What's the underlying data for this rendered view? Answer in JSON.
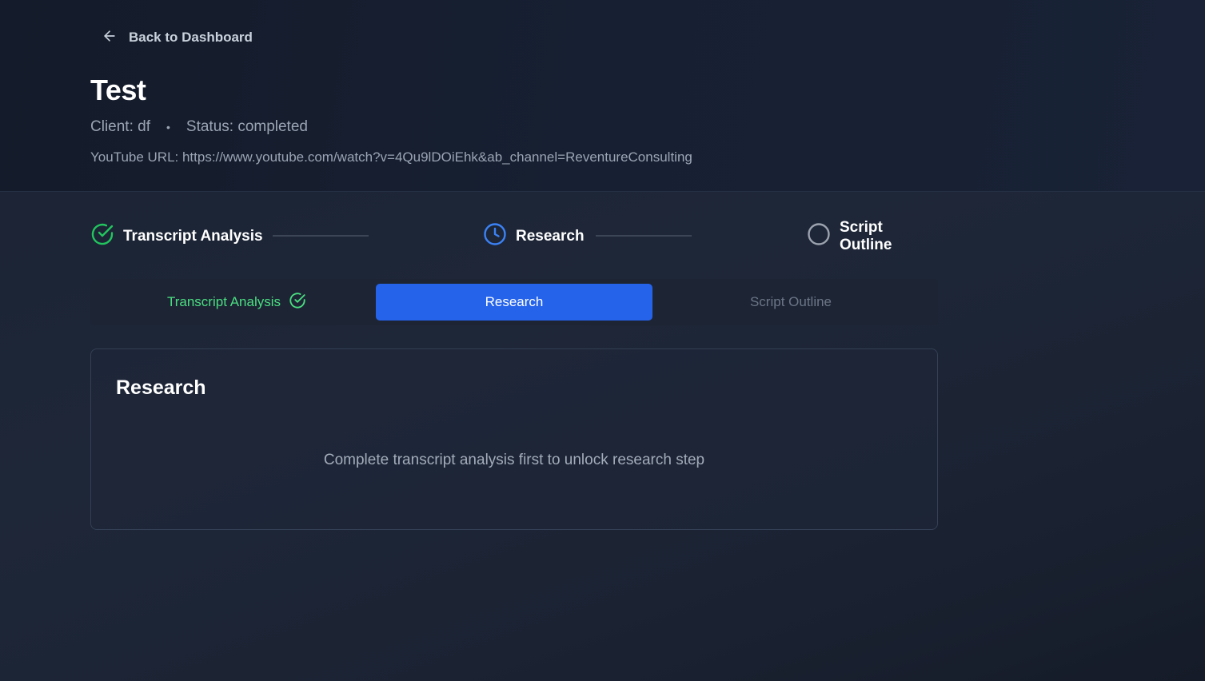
{
  "nav": {
    "back_label": "Back to Dashboard",
    "back_icon": "arrow-left-icon"
  },
  "project": {
    "title": "Test",
    "client": "Client: df",
    "separator": "•",
    "status": "Status: completed",
    "youtube_url": "YouTube URL: https://www.youtube.com/watch?v=4Qu9lDOiEhk&ab_channel=ReventureConsulting"
  },
  "stepper": {
    "steps": [
      {
        "label": "Transcript Analysis",
        "state": "completed",
        "icon": "check-circle-icon",
        "color": "#22c55e"
      },
      {
        "label": "Research",
        "state": "in-progress",
        "icon": "clock-icon",
        "color": "#3b82f6"
      },
      {
        "label": "Script Outline",
        "state": "pending",
        "icon": "empty-circle-icon",
        "color": "#9ca3af"
      }
    ]
  },
  "tabs": {
    "items": [
      {
        "label": "Transcript Analysis",
        "state": "done",
        "icon": "check-circle-icon"
      },
      {
        "label": "Research",
        "state": "active"
      },
      {
        "label": "Script Outline",
        "state": "locked"
      }
    ],
    "active_color": "#2563eb"
  },
  "panel": {
    "title": "Research",
    "message": "Complete transcript analysis first to unlock research step"
  }
}
